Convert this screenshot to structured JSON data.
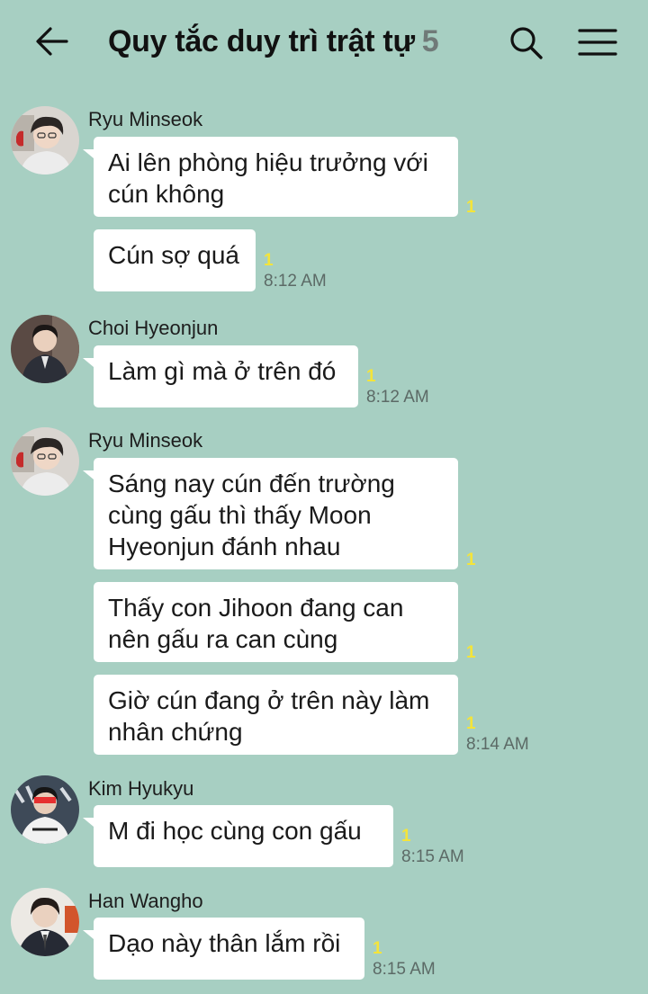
{
  "header": {
    "title": "Quy tắc duy trì trật tự",
    "member_count": "5"
  },
  "messages": [
    {
      "sender": "Ryu Minseok",
      "bubbles": [
        {
          "lines": [
            "Ai lên phòng hiệu trưởng với",
            "cún không"
          ],
          "unread": "1",
          "time": ""
        },
        {
          "lines": [
            "Cún sợ quá"
          ],
          "unread": "1",
          "time": "8:12 AM"
        }
      ]
    },
    {
      "sender": "Choi Hyeonjun",
      "bubbles": [
        {
          "lines": [
            "Làm gì mà ở trên đó"
          ],
          "unread": "1",
          "time": "8:12 AM"
        }
      ]
    },
    {
      "sender": "Ryu Minseok",
      "bubbles": [
        {
          "lines": [
            "Sáng nay cún đến trường",
            "cùng gấu thì thấy Moon",
            "Hyeonjun đánh nhau"
          ],
          "unread": "1",
          "time": ""
        },
        {
          "lines": [
            "Thấy con Jihoon đang can",
            "nên gấu ra can cùng"
          ],
          "unread": "1",
          "time": ""
        },
        {
          "lines": [
            "Giờ cún đang ở trên này làm",
            "nhân chứng"
          ],
          "unread": "1",
          "time": "8:14 AM"
        }
      ]
    },
    {
      "sender": "Kim Hyukyu",
      "bubbles": [
        {
          "lines": [
            "M đi học cùng con gấu"
          ],
          "unread": "1",
          "time": "8:15 AM"
        }
      ]
    },
    {
      "sender": "Han Wangho",
      "bubbles": [
        {
          "lines": [
            "Dạo này thân lắm rồi"
          ],
          "unread": "1",
          "time": "8:15 AM"
        }
      ]
    }
  ],
  "colors": {
    "background": "#a7cfc2",
    "bubble": "#ffffff",
    "unread": "#f4e43a",
    "count": "#707a78"
  },
  "icons": [
    "back-arrow-icon",
    "search-icon",
    "menu-icon"
  ]
}
